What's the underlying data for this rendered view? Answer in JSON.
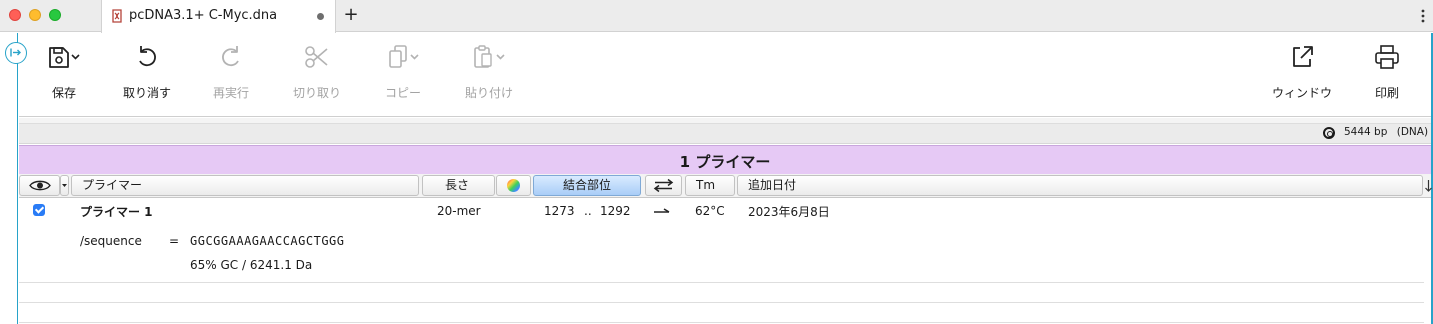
{
  "window": {
    "tab_title": "pcDNA3.1+ C-Myc.dna",
    "new_tab": "+"
  },
  "toolbar": {
    "save": "保存",
    "undo": "取り消す",
    "redo": "再実行",
    "cut": "切り取り",
    "copy": "コピー",
    "paste": "貼り付け",
    "window": "ウィンドウ",
    "print": "印刷"
  },
  "info": {
    "length": "5444 bp",
    "type": "(DNA)"
  },
  "primer_panel": {
    "title": "1 プライマー",
    "columns": {
      "name": "プライマー",
      "length": "長さ",
      "binding_site": "結合部位",
      "tm": "Tm",
      "date_added": "追加日付"
    }
  },
  "primers": [
    {
      "checked": true,
      "name": "プライマー 1",
      "length": "20-mer",
      "binding_start": "1273",
      "binding_sep": "..",
      "binding_end": "1292",
      "tm": "62°C",
      "date_added": "2023年6月8日",
      "sequence_label": "/sequence",
      "sequence_eq": "=",
      "sequence": "GGCGGAAAGAACCAGCTGGG",
      "gc_mw": "65% GC  /  6241.1 Da"
    }
  ],
  "colors": {
    "accent": "#27a3c9",
    "primer_header_bg": "#e6c9f5",
    "selected_column": "#a9cdf7",
    "checkbox": "#2a7cf6"
  }
}
